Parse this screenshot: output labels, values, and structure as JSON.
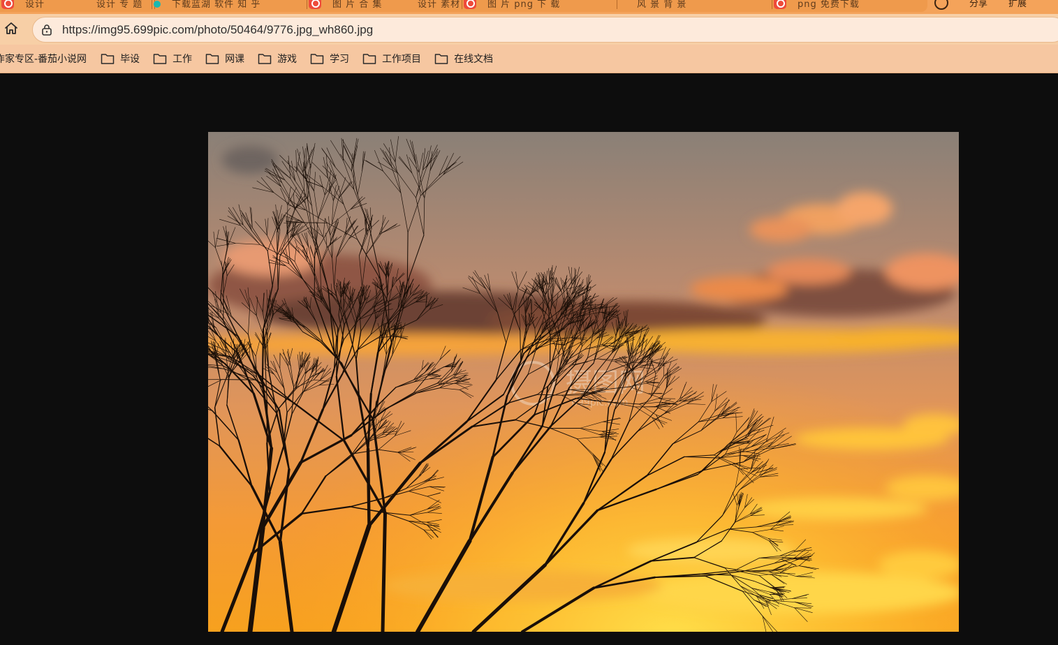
{
  "browser": {
    "tabs": [
      {
        "label": "设计",
        "icon": "tab-favicon"
      },
      {
        "label": "设计 专 题",
        "icon": "none"
      },
      {
        "label": "下载蓝湖 软件 知 乎",
        "icon": "teal-favicon"
      },
      {
        "label": "图 片 合 集",
        "icon": "tab-favicon"
      },
      {
        "label": "设计 素材",
        "icon": "none"
      },
      {
        "label": "图 片 png 下 载",
        "icon": "tab-favicon"
      },
      {
        "label": "风 景 背 景",
        "icon": "none"
      },
      {
        "label": "png 免费下载",
        "icon": "tab-favicon"
      }
    ],
    "tabstrip_right": [
      "",
      "分享",
      "扩展"
    ],
    "address": {
      "url": "https://img95.699pic.com/photo/50464/9776.jpg_wh860.jpg"
    },
    "bookmarks": [
      {
        "label": "作家专区-番茄小说网",
        "folder": false
      },
      {
        "label": "毕设",
        "folder": true
      },
      {
        "label": "工作",
        "folder": true
      },
      {
        "label": "网课",
        "folder": true
      },
      {
        "label": "游戏",
        "folder": true
      },
      {
        "label": "学习",
        "folder": true
      },
      {
        "label": "工作项目",
        "folder": true
      },
      {
        "label": "在线文档",
        "folder": true
      }
    ]
  },
  "photo": {
    "subject": "sunset-tree-silhouette",
    "watermark_text": "摄图网",
    "watermark_sub": "699pic.com",
    "colors": {
      "sky_top": "#8e8378",
      "sky_mid": "#d39064",
      "sky_low": "#f39a3c",
      "glow": "#ffcf3a",
      "branches": "#1a0f08"
    }
  },
  "viewer": {
    "background": "#0d0d0d"
  }
}
